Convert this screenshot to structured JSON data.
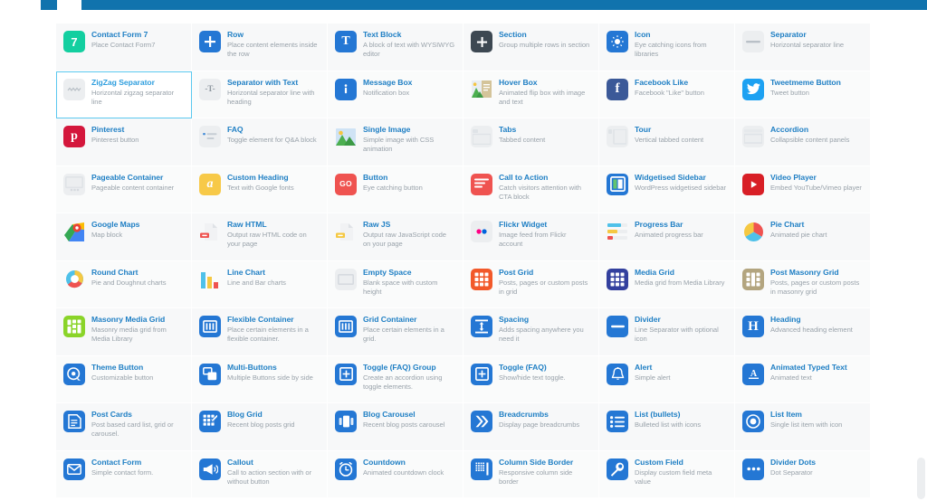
{
  "window": {
    "accent_color": "#1173ad",
    "title_color": "#1f7fc4",
    "selected_border_color": "#5bc8ef"
  },
  "elements": [
    {
      "title": "Contact Form 7",
      "desc": "Place Contact Form7",
      "icon": "contact-form-7-icon",
      "style": "teal",
      "glyph": "7",
      "selected": false
    },
    {
      "title": "Row",
      "desc": "Place content elements inside the row",
      "icon": "plus-icon",
      "style": "blue",
      "glyph": "+",
      "selected": false
    },
    {
      "title": "Text Block",
      "desc": "A block of text with WYSIWYG editor",
      "icon": "text-block-icon",
      "style": "blue",
      "glyph": "T",
      "selected": false
    },
    {
      "title": "Section",
      "desc": "Group multiple rows in section",
      "icon": "section-icon",
      "style": "dark",
      "glyph": "+",
      "selected": false
    },
    {
      "title": "Icon",
      "desc": "Eye catching icons from libraries",
      "icon": "sun-icon",
      "style": "blue",
      "glyph": "☀",
      "selected": false
    },
    {
      "title": "Separator",
      "desc": "Horizontal separator line",
      "icon": "separator-icon",
      "style": "grey",
      "glyph": "—",
      "selected": false
    },
    {
      "title": "ZigZag Separator",
      "desc": "Horizontal zigzag separator line",
      "icon": "zigzag-separator-icon",
      "style": "grey",
      "glyph": "∿",
      "selected": true
    },
    {
      "title": "Separator with Text",
      "desc": "Horizontal separator line with heading",
      "icon": "separator-with-text-icon",
      "style": "grey",
      "glyph": "-T-",
      "selected": false
    },
    {
      "title": "Message Box",
      "desc": "Notification box",
      "icon": "info-icon",
      "style": "blue",
      "glyph": "i",
      "selected": false
    },
    {
      "title": "Hover Box",
      "desc": "Animated flip box with image and text",
      "icon": "hover-box-icon",
      "style": "none",
      "glyph": "",
      "selected": false
    },
    {
      "title": "Facebook Like",
      "desc": "Facebook \"Like\" button",
      "icon": "facebook-icon",
      "style": "fb",
      "glyph": "f",
      "selected": false
    },
    {
      "title": "Tweetmeme Button",
      "desc": "Tweet button",
      "icon": "twitter-icon",
      "style": "tw",
      "glyph": "ᴠ",
      "selected": false
    },
    {
      "title": "Pinterest",
      "desc": "Pinterest button",
      "icon": "pinterest-icon",
      "style": "pin",
      "glyph": "P",
      "selected": false
    },
    {
      "title": "FAQ",
      "desc": "Toggle element for Q&A block",
      "icon": "faq-icon",
      "style": "grey",
      "glyph": "",
      "selected": false
    },
    {
      "title": "Single Image",
      "desc": "Simple image with CSS animation",
      "icon": "image-icon",
      "style": "none",
      "glyph": "",
      "selected": false
    },
    {
      "title": "Tabs",
      "desc": "Tabbed content",
      "icon": "tabs-icon",
      "style": "grey",
      "glyph": "",
      "selected": false
    },
    {
      "title": "Tour",
      "desc": "Vertical tabbed content",
      "icon": "tour-icon",
      "style": "grey",
      "glyph": "",
      "selected": false
    },
    {
      "title": "Accordion",
      "desc": "Collapsible content panels",
      "icon": "accordion-icon",
      "style": "grey",
      "glyph": "",
      "selected": false
    },
    {
      "title": "Pageable Container",
      "desc": "Pageable content container",
      "icon": "pageable-container-icon",
      "style": "grey",
      "glyph": "",
      "selected": false
    },
    {
      "title": "Custom Heading",
      "desc": "Text with Google fonts",
      "icon": "custom-heading-icon",
      "style": "yellow",
      "glyph": "a",
      "selected": false
    },
    {
      "title": "Button",
      "desc": "Eye catching button",
      "icon": "button-icon",
      "style": "red",
      "glyph": "GO",
      "selected": false
    },
    {
      "title": "Call to Action",
      "desc": "Catch visitors attention with CTA block",
      "icon": "call-to-action-icon",
      "style": "red",
      "glyph": "",
      "selected": false
    },
    {
      "title": "Widgetised Sidebar",
      "desc": "WordPress widgetised sidebar",
      "icon": "widgetised-sidebar-icon",
      "style": "blue",
      "glyph": "",
      "selected": false
    },
    {
      "title": "Video Player",
      "desc": "Embed YouTube/Vimeo player",
      "icon": "video-player-icon",
      "style": "yt",
      "glyph": "▶",
      "selected": false
    },
    {
      "title": "Google Maps",
      "desc": "Map block",
      "icon": "google-maps-icon",
      "style": "none",
      "glyph": "",
      "selected": false
    },
    {
      "title": "Raw HTML",
      "desc": "Output raw HTML code on your page",
      "icon": "raw-html-icon",
      "style": "none",
      "glyph": "",
      "selected": false
    },
    {
      "title": "Raw JS",
      "desc": "Output raw JavaScript code on your page",
      "icon": "raw-js-icon",
      "style": "none",
      "glyph": "",
      "selected": false
    },
    {
      "title": "Flickr Widget",
      "desc": "Image feed from Flickr account",
      "icon": "flickr-icon",
      "style": "grey",
      "glyph": "",
      "selected": false
    },
    {
      "title": "Progress Bar",
      "desc": "Animated progress bar",
      "icon": "progress-bar-icon",
      "style": "none",
      "glyph": "",
      "selected": false
    },
    {
      "title": "Pie Chart",
      "desc": "Animated pie chart",
      "icon": "pie-chart-icon",
      "style": "none",
      "glyph": "",
      "selected": false
    },
    {
      "title": "Round Chart",
      "desc": "Pie and Doughnut charts",
      "icon": "round-chart-icon",
      "style": "none",
      "glyph": "",
      "selected": false
    },
    {
      "title": "Line Chart",
      "desc": "Line and Bar charts",
      "icon": "line-chart-icon",
      "style": "none",
      "glyph": "",
      "selected": false
    },
    {
      "title": "Empty Space",
      "desc": "Blank space with custom height",
      "icon": "empty-space-icon",
      "style": "grey",
      "glyph": "",
      "selected": false
    },
    {
      "title": "Post Grid",
      "desc": "Posts, pages or custom posts in grid",
      "icon": "post-grid-icon",
      "style": "orange",
      "glyph": "",
      "selected": false
    },
    {
      "title": "Media Grid",
      "desc": "Media grid from Media Library",
      "icon": "media-grid-icon",
      "style": "navy",
      "glyph": "",
      "selected": false
    },
    {
      "title": "Post Masonry Grid",
      "desc": "Posts, pages or custom posts in masonry grid",
      "icon": "post-masonry-grid-icon",
      "style": "tan",
      "glyph": "",
      "selected": false
    },
    {
      "title": "Masonry Media Grid",
      "desc": "Masonry media grid from Media Library",
      "icon": "masonry-media-grid-icon",
      "style": "lime",
      "glyph": "",
      "selected": false
    },
    {
      "title": "Flexible Container",
      "desc": "Place certain elements in a flexible container.",
      "icon": "flexible-container-icon",
      "style": "blue",
      "glyph": "",
      "selected": false
    },
    {
      "title": "Grid Container",
      "desc": "Place certain elements in a grid.",
      "icon": "grid-container-icon",
      "style": "blue",
      "glyph": "",
      "selected": false
    },
    {
      "title": "Spacing",
      "desc": "Adds spacing anywhere you need it",
      "icon": "spacing-icon",
      "style": "blue",
      "glyph": "",
      "selected": false
    },
    {
      "title": "Divider",
      "desc": "Line Separator with optional icon",
      "icon": "divider-icon",
      "style": "blue",
      "glyph": "—",
      "selected": false
    },
    {
      "title": "Heading",
      "desc": "Advanced heading element",
      "icon": "heading-icon",
      "style": "blue",
      "glyph": "H",
      "selected": false
    },
    {
      "title": "Theme Button",
      "desc": "Customizable button",
      "icon": "theme-button-icon",
      "style": "blue",
      "glyph": "",
      "selected": false
    },
    {
      "title": "Multi-Buttons",
      "desc": "Multiple Buttons side by side",
      "icon": "multi-buttons-icon",
      "style": "blue",
      "glyph": "",
      "selected": false
    },
    {
      "title": "Toggle (FAQ) Group",
      "desc": "Create an accordion using toggle elements.",
      "icon": "toggle-group-icon",
      "style": "blue",
      "glyph": "⊞",
      "selected": false
    },
    {
      "title": "Toggle (FAQ)",
      "desc": "Show/hide text toggle.",
      "icon": "toggle-icon",
      "style": "blue",
      "glyph": "⊞",
      "selected": false
    },
    {
      "title": "Alert",
      "desc": "Simple alert",
      "icon": "bell-icon",
      "style": "blue",
      "glyph": "ὑ4",
      "selected": false
    },
    {
      "title": "Animated Typed Text",
      "desc": "Animated text",
      "icon": "animated-typed-text-icon",
      "style": "blue",
      "glyph": "A",
      "selected": false
    },
    {
      "title": "Post Cards",
      "desc": "Post based card list, grid or carousel.",
      "icon": "post-cards-icon",
      "style": "blue",
      "glyph": "",
      "selected": false
    },
    {
      "title": "Blog Grid",
      "desc": "Recent blog posts grid",
      "icon": "blog-grid-icon",
      "style": "blue",
      "glyph": "",
      "selected": false
    },
    {
      "title": "Blog Carousel",
      "desc": "Recent blog posts carousel",
      "icon": "blog-carousel-icon",
      "style": "blue",
      "glyph": "",
      "selected": false
    },
    {
      "title": "Breadcrumbs",
      "desc": "Display page breadcrumbs",
      "icon": "breadcrumbs-icon",
      "style": "blue",
      "glyph": "»",
      "selected": false
    },
    {
      "title": "List (bullets)",
      "desc": "Bulleted list with icons",
      "icon": "list-bullets-icon",
      "style": "blue",
      "glyph": "",
      "selected": false
    },
    {
      "title": "List Item",
      "desc": "Single list item with icon",
      "icon": "list-item-icon",
      "style": "blue",
      "glyph": "◎",
      "selected": false
    },
    {
      "title": "Contact Form",
      "desc": "Simple contact form.",
      "icon": "contact-form-icon",
      "style": "blue",
      "glyph": "✉",
      "selected": false
    },
    {
      "title": "Callout",
      "desc": "Call to action section with or without button",
      "icon": "callout-icon",
      "style": "blue",
      "glyph": "",
      "selected": false
    },
    {
      "title": "Countdown",
      "desc": "Animated countdown clock",
      "icon": "countdown-icon",
      "style": "blue",
      "glyph": "⏰",
      "selected": false
    },
    {
      "title": "Column Side Border",
      "desc": "Responsive column side border",
      "icon": "column-side-border-icon",
      "style": "blue",
      "glyph": "",
      "selected": false
    },
    {
      "title": "Custom Field",
      "desc": "Display custom field meta value",
      "icon": "custom-field-icon",
      "style": "blue",
      "glyph": "⚒",
      "selected": false
    },
    {
      "title": "Divider Dots",
      "desc": "Dot Separator",
      "icon": "divider-dots-icon",
      "style": "blue",
      "glyph": "•••",
      "selected": false
    }
  ]
}
